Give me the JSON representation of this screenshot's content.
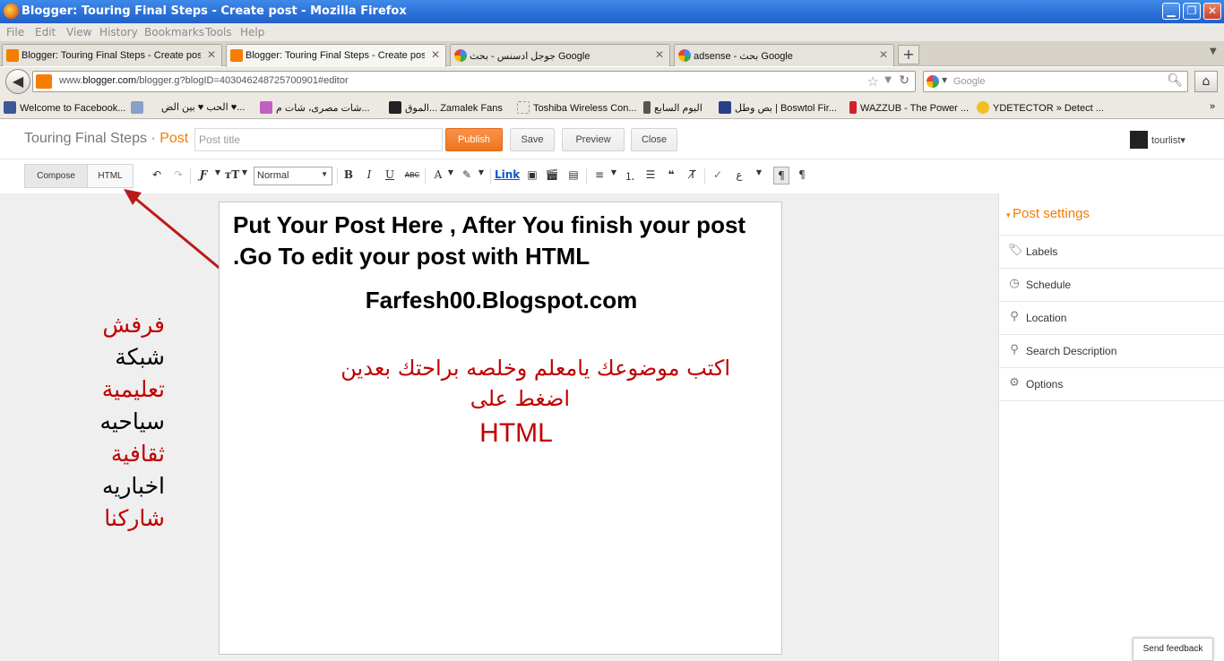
{
  "window": {
    "title": "Blogger: Touring Final Steps - Create post - Mozilla Firefox",
    "buttons": {
      "minimize": "▁",
      "maximize": "❐",
      "close": "✕"
    }
  },
  "menu": [
    "File",
    "Edit",
    "View",
    "History",
    "Bookmarks",
    "Tools",
    "Help"
  ],
  "tabs": [
    {
      "label": "Blogger: Touring Final Steps - Create post",
      "icon": "blogger-icon",
      "active": false
    },
    {
      "label": "Blogger: Touring Final Steps - Create post",
      "icon": "blogger-icon",
      "active": true
    },
    {
      "label": "جوجل ادسنس - بحث Google",
      "icon": "google-icon",
      "active": false
    },
    {
      "label": "adsense - بحث Google",
      "icon": "google-icon",
      "active": false
    }
  ],
  "tab_close": "✕",
  "new_tab": "+",
  "navbar": {
    "url_prefix": "www.",
    "url_host": "blogger.com",
    "url_rest": "/blogger.g?blogID=403046248725700901#editor",
    "search_placeholder": "Google"
  },
  "bookmarks": [
    {
      "label": "Welcome to Facebook...",
      "icon": "facebook-icon",
      "color": "#3b5998"
    },
    {
      "label": "",
      "icon": "bookmark-img-icon",
      "color": "#8aa0c8"
    },
    {
      "label": "الحب ♥ بين الض ♥...",
      "icon": "heart-icon",
      "color": ""
    },
    {
      "label": "شات مصرى، شات م...",
      "icon": "chat-icon",
      "color": "#c060c0"
    },
    {
      "label": "الموق... Zamalek Fans",
      "icon": "z-icon",
      "color": ""
    },
    {
      "label": "Toshiba Wireless Con...",
      "icon": "blank-page-icon",
      "color": ""
    },
    {
      "label": "اليوم السابع",
      "icon": "news-icon",
      "color": ""
    },
    {
      "label": "بص وطل | Boswtol Fir...",
      "icon": "boswtol-icon",
      "color": "#2a3f8a"
    },
    {
      "label": "WAZZUB - The Power ...",
      "icon": "wazzub-icon",
      "color": "#d0202a"
    },
    {
      "label": "YDETECTOR » Detect ...",
      "icon": "smiley-icon",
      "color": "#f0c020"
    }
  ],
  "blogger": {
    "blog_name": "Touring Final Steps",
    "separator": " · ",
    "section": "Post",
    "post_title_placeholder": "Post title",
    "buttons": {
      "publish": "Publish",
      "save": "Save",
      "preview": "Preview",
      "close": "Close"
    },
    "user": "tourlist▾"
  },
  "toolbar": {
    "compose": "Compose",
    "html": "HTML",
    "font_size": "Normal",
    "link": "Link"
  },
  "editor": {
    "heading": "Put Your Post Here , After You finish your post .Go To edit your post with HTML",
    "site": "Farfesh00.Blogspot.com",
    "arabic_line1": "اكتب موضوعك يامعلم وخلصه براحتك بعدين",
    "arabic_line2": "اضغط على",
    "html_word": "HTML"
  },
  "side_words": [
    {
      "text": "فرفش",
      "color": "#c00000"
    },
    {
      "text": "شبكة",
      "color": "#000000"
    },
    {
      "text": "تعليمية",
      "color": "#c00000"
    },
    {
      "text": "سياحيه",
      "color": "#000000"
    },
    {
      "text": "ثقافية",
      "color": "#c00000"
    },
    {
      "text": "اخباريه",
      "color": "#000000"
    },
    {
      "text": "شاركنا",
      "color": "#c00000"
    }
  ],
  "settings": {
    "title": "Post settings",
    "items": [
      {
        "label": "Labels",
        "icon": "tag-icon"
      },
      {
        "label": "Schedule",
        "icon": "clock-icon"
      },
      {
        "label": "Location",
        "icon": "pin-icon"
      },
      {
        "label": "Search Description",
        "icon": "search-icon"
      },
      {
        "label": "Options",
        "icon": "gear-icon"
      }
    ]
  },
  "feedback": "Send feedback",
  "colors": {
    "accent": "#f57d00",
    "annotation": "#c00000",
    "titlebar": "#2a6fd6"
  }
}
